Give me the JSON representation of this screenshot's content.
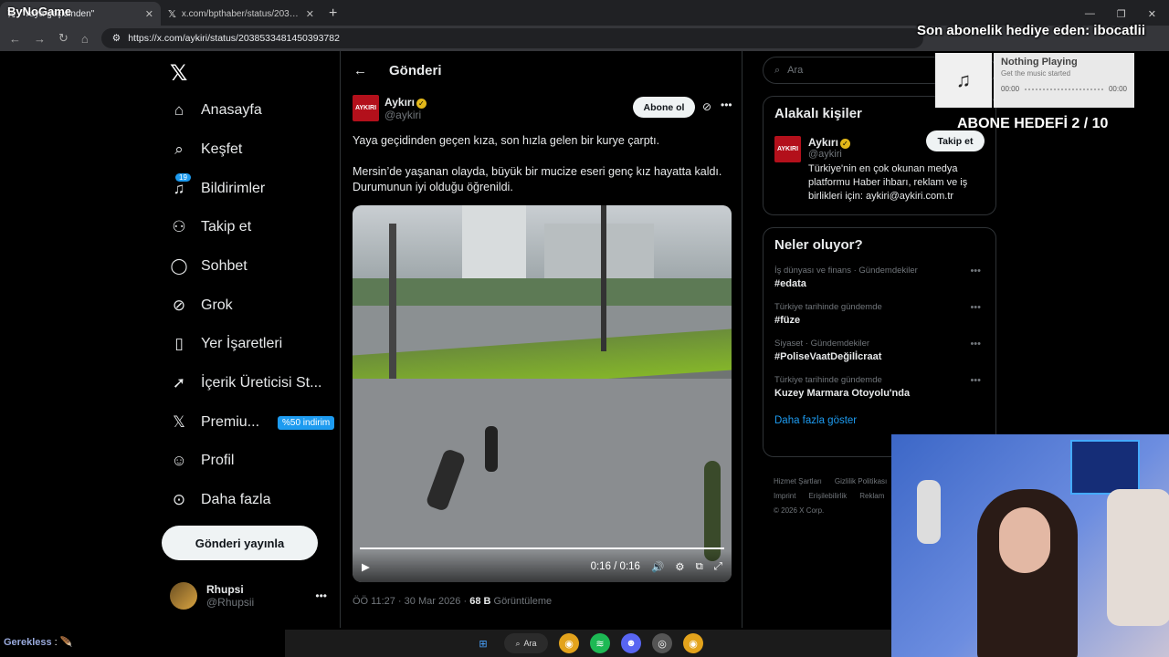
{
  "browser": {
    "tabs": [
      {
        "title": "\"Yaya geçidinden\"",
        "favicon": "x-favicon",
        "active": true
      },
      {
        "title": "x.com/bpthaber/status/203824",
        "favicon": "x-favicon",
        "active": false
      }
    ],
    "url": "https://x.com/aykiri/status/2038533481450393782"
  },
  "overlay": {
    "logo": "ByNoGame",
    "sub_gift": "Son abonelik hediye eden: ibocatlii",
    "music_title": "Nothing Playing",
    "music_sub": "Get the music started",
    "music_time_start": "00:00",
    "music_time_end": "00:00",
    "goal": "ABONE HEDEFİ 2 / 10",
    "chat_user": "Gerekless",
    "chat_sep": ":"
  },
  "nav": {
    "items": [
      {
        "label": "Anasayfa",
        "icon": "home-icon"
      },
      {
        "label": "Keşfet",
        "icon": "search-icon"
      },
      {
        "label": "Bildirimler",
        "icon": "bell-icon",
        "badge": "19"
      },
      {
        "label": "Takip et",
        "icon": "person-plus-icon"
      },
      {
        "label": "Sohbet",
        "icon": "chat-icon"
      },
      {
        "label": "Grok",
        "icon": "grok-icon"
      },
      {
        "label": "Yer İşaretleri",
        "icon": "bookmark-icon"
      },
      {
        "label": "İçerik Üreticisi St...",
        "icon": "rocket-icon"
      },
      {
        "label": "Premiu...",
        "icon": "x-icon",
        "badge": "%50 indirim"
      },
      {
        "label": "Profil",
        "icon": "person-icon"
      },
      {
        "label": "Daha fazla",
        "icon": "more-circle-icon"
      }
    ],
    "post_button": "Gönderi yayınla",
    "account": {
      "name": "Rhupsi",
      "handle": "@Rhupsii"
    }
  },
  "main": {
    "header_title": "Gönderi",
    "author": {
      "name": "Aykırı",
      "handle": "@aykiri",
      "brand": "AYKIRI"
    },
    "subscribe": "Abone ol",
    "text_1": "Yaya geçidinden geçen kıza, son hızla gelen bir kurye çarptı.",
    "text_2": "Mersin’de yaşanan olayda, büyük bir mucize eseri genç kız hayatta kaldı. Durumunun iyi olduğu öğrenildi.",
    "video_time": "0:16 / 0:16",
    "meta_time": "ÖÖ 11:27 · 30 Mar 2026 · ",
    "views_count": "68 B",
    "views_label": " Görüntüleme"
  },
  "right": {
    "search_placeholder": "Ara",
    "related_title": "Alakalı kişiler",
    "related_person": {
      "name": "Aykırı",
      "handle": "@aykiri",
      "bio": "Türkiye'nin en çok okunan medya platformu Haber ihbarı, reklam ve iş birlikleri için: aykiri@aykiri.com.tr",
      "follow": "Takip et"
    },
    "trends_title": "Neler oluyor?",
    "trends": [
      {
        "category": "İş dünyası ve finans · Gündemdekiler",
        "title": "#edata"
      },
      {
        "category": "Türkiye tarihinde gündemde",
        "title": "#füze"
      },
      {
        "category": "Siyaset · Gündemdekiler",
        "title": "#PoliseVaatDeğilİcraat"
      },
      {
        "category": "Türkiye tarihinde gündemde",
        "title": "Kuzey Marmara Otoyolu'nda"
      }
    ],
    "show_more": "Daha fazla göster",
    "footer": [
      "Hizmet Şartları",
      "Gizlilik Politikası",
      "Imprint",
      "Erişilebilirlik",
      "Reklam",
      "© 2026 X Corp."
    ]
  },
  "taskbar": {
    "search": "Ara"
  }
}
